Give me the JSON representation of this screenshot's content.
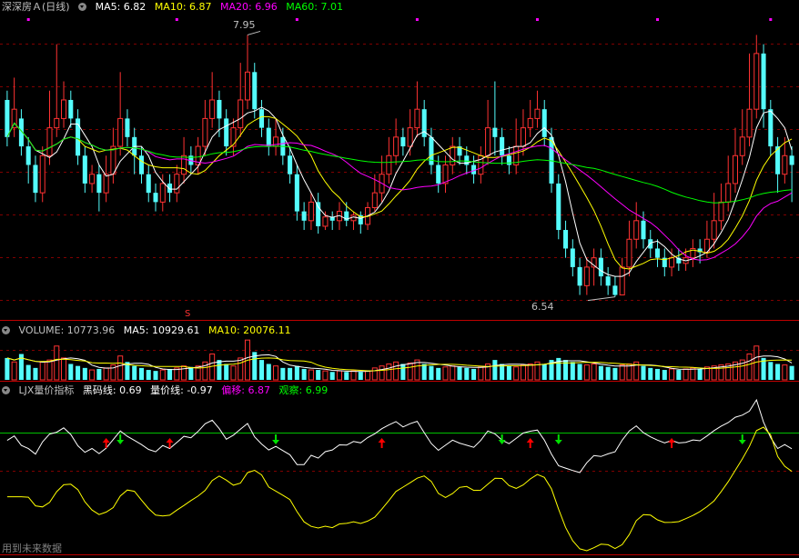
{
  "colors": {
    "up": "#ff3232",
    "down": "#54fcfc",
    "ma5": "#ffffff",
    "ma10": "#ffff00",
    "ma20": "#ff00ff",
    "ma60": "#00ff00",
    "grid": "#800000",
    "text": "#c0c0c0"
  },
  "main": {
    "title": "深深房Ａ(日线)",
    "ma5_label": "MA5: 6.82",
    "ma10_label": "MA10: 6.87",
    "ma20_label": "MA20: 6.96",
    "ma60_label": "MA60: 7.01",
    "high_label": "7.95",
    "low_label": "6.54",
    "marker_label": "S"
  },
  "volume": {
    "title": "VOLUME: 10773.96",
    "ma5_label": "MA5: 10929.61",
    "ma10_label": "MA10: 20076.11"
  },
  "indicator": {
    "title": "LJX量价指标",
    "black_label": "黑码线: 0.69",
    "price_label": "量价线: -0.97",
    "offset_label": "偏移: 6.87",
    "watch_label": "观察: 6.99"
  },
  "footer": {
    "label": "用到未来数据"
  },
  "chart_data": [
    {
      "type": "candlestick",
      "title": "深深房Ａ(日线)",
      "ylim": [
        6.45,
        8.05
      ],
      "annotations": [
        {
          "text": "7.95",
          "kind": "high"
        },
        {
          "text": "6.54",
          "kind": "low"
        }
      ],
      "series": [
        {
          "name": "MA5",
          "value": 6.82
        },
        {
          "name": "MA10",
          "value": 6.87
        },
        {
          "name": "MA20",
          "value": 6.96
        },
        {
          "name": "MA60",
          "value": 7.01
        }
      ],
      "ohlc": [
        [
          7.6,
          7.4,
          7.65,
          7.35
        ],
        [
          7.45,
          7.55,
          7.72,
          7.4
        ],
        [
          7.5,
          7.35,
          7.55,
          7.3
        ],
        [
          7.35,
          7.25,
          7.4,
          7.15
        ],
        [
          7.25,
          7.1,
          7.3,
          7.05
        ],
        [
          7.1,
          7.3,
          7.35,
          7.05
        ],
        [
          7.3,
          7.45,
          7.65,
          7.25
        ],
        [
          7.45,
          7.5,
          7.9,
          7.4
        ],
        [
          7.5,
          7.6,
          7.7,
          7.45
        ],
        [
          7.6,
          7.5,
          7.65,
          7.45
        ],
        [
          7.5,
          7.3,
          7.55,
          7.25
        ],
        [
          7.3,
          7.15,
          7.35,
          7.1
        ],
        [
          7.15,
          7.2,
          7.25,
          7.1
        ],
        [
          7.2,
          7.1,
          7.25,
          7.0
        ],
        [
          7.1,
          7.2,
          7.3,
          7.05
        ],
        [
          7.2,
          7.35,
          7.45,
          7.15
        ],
        [
          7.35,
          7.5,
          7.75,
          7.3
        ],
        [
          7.5,
          7.4,
          7.55,
          7.35
        ],
        [
          7.4,
          7.3,
          7.45,
          7.2
        ],
        [
          7.3,
          7.2,
          7.35,
          7.15
        ],
        [
          7.2,
          7.1,
          7.25,
          7.05
        ],
        [
          7.1,
          7.05,
          7.15,
          7.0
        ],
        [
          7.05,
          7.15,
          7.2,
          7.0
        ],
        [
          7.15,
          7.1,
          7.2,
          7.05
        ],
        [
          7.1,
          7.2,
          7.25,
          7.05
        ],
        [
          7.2,
          7.3,
          7.4,
          7.15
        ],
        [
          7.3,
          7.25,
          7.35,
          7.2
        ],
        [
          7.25,
          7.35,
          7.4,
          7.2
        ],
        [
          7.35,
          7.5,
          7.6,
          7.3
        ],
        [
          7.5,
          7.6,
          7.75,
          7.45
        ],
        [
          7.6,
          7.5,
          7.65,
          7.4
        ],
        [
          7.5,
          7.35,
          7.55,
          7.3
        ],
        [
          7.35,
          7.45,
          7.5,
          7.3
        ],
        [
          7.45,
          7.6,
          7.8,
          7.4
        ],
        [
          7.6,
          7.75,
          7.95,
          7.55
        ],
        [
          7.75,
          7.55,
          7.8,
          7.5
        ],
        [
          7.55,
          7.45,
          7.6,
          7.4
        ],
        [
          7.45,
          7.35,
          7.5,
          7.3
        ],
        [
          7.35,
          7.4,
          7.5,
          7.3
        ],
        [
          7.4,
          7.3,
          7.45,
          7.25
        ],
        [
          7.3,
          7.2,
          7.35,
          7.15
        ],
        [
          7.2,
          7.0,
          7.25,
          6.95
        ],
        [
          7.0,
          6.95,
          7.05,
          6.9
        ],
        [
          6.95,
          7.05,
          7.1,
          6.9
        ],
        [
          7.05,
          6.92,
          7.1,
          6.88
        ],
        [
          6.92,
          6.97,
          7.0,
          6.9
        ],
        [
          6.97,
          6.95,
          7.0,
          6.9
        ],
        [
          6.95,
          7.0,
          7.05,
          6.9
        ],
        [
          7.0,
          6.95,
          7.05,
          6.92
        ],
        [
          6.95,
          6.98,
          7.0,
          6.9
        ],
        [
          6.98,
          6.93,
          7.0,
          6.88
        ],
        [
          6.93,
          7.02,
          7.05,
          6.9
        ],
        [
          7.02,
          7.1,
          7.2,
          7.0
        ],
        [
          7.1,
          7.2,
          7.3,
          7.05
        ],
        [
          7.2,
          7.3,
          7.4,
          7.15
        ],
        [
          7.3,
          7.4,
          7.5,
          7.25
        ],
        [
          7.4,
          7.35,
          7.45,
          7.3
        ],
        [
          7.35,
          7.45,
          7.55,
          7.3
        ],
        [
          7.45,
          7.55,
          7.7,
          7.4
        ],
        [
          7.55,
          7.4,
          7.6,
          7.35
        ],
        [
          7.4,
          7.25,
          7.45,
          7.2
        ],
        [
          7.25,
          7.15,
          7.3,
          7.1
        ],
        [
          7.15,
          7.25,
          7.3,
          7.1
        ],
        [
          7.25,
          7.35,
          7.4,
          7.2
        ],
        [
          7.35,
          7.3,
          7.4,
          7.25
        ],
        [
          7.3,
          7.25,
          7.35,
          7.2
        ],
        [
          7.25,
          7.2,
          7.3,
          7.15
        ],
        [
          7.2,
          7.3,
          7.35,
          7.15
        ],
        [
          7.3,
          7.45,
          7.6,
          7.25
        ],
        [
          7.45,
          7.4,
          7.7,
          7.3
        ],
        [
          7.4,
          7.3,
          7.45,
          7.25
        ],
        [
          7.3,
          7.25,
          7.35,
          7.2
        ],
        [
          7.25,
          7.35,
          7.5,
          7.2
        ],
        [
          7.35,
          7.45,
          7.55,
          7.3
        ],
        [
          7.45,
          7.5,
          7.6,
          7.4
        ],
        [
          7.5,
          7.55,
          7.65,
          7.45
        ],
        [
          7.55,
          7.4,
          7.6,
          7.35
        ],
        [
          7.4,
          7.15,
          7.45,
          7.1
        ],
        [
          7.15,
          6.9,
          7.2,
          6.85
        ],
        [
          6.9,
          6.8,
          6.95,
          6.75
        ],
        [
          6.8,
          6.7,
          6.85,
          6.65
        ],
        [
          6.7,
          6.6,
          6.75,
          6.55
        ],
        [
          6.6,
          6.7,
          6.75,
          6.55
        ],
        [
          6.7,
          6.75,
          6.8,
          6.6
        ],
        [
          6.75,
          6.65,
          6.8,
          6.6
        ],
        [
          6.65,
          6.6,
          6.7,
          6.55
        ],
        [
          6.6,
          6.55,
          6.65,
          6.54
        ],
        [
          6.55,
          6.7,
          6.75,
          6.55
        ],
        [
          6.7,
          6.85,
          6.95,
          6.65
        ],
        [
          6.85,
          6.95,
          7.05,
          6.8
        ],
        [
          6.95,
          6.85,
          7.0,
          6.8
        ],
        [
          6.85,
          6.8,
          6.9,
          6.75
        ],
        [
          6.8,
          6.75,
          6.85,
          6.7
        ],
        [
          6.75,
          6.7,
          6.8,
          6.65
        ],
        [
          6.7,
          6.75,
          6.8,
          6.65
        ],
        [
          6.75,
          6.72,
          6.8,
          6.68
        ],
        [
          6.72,
          6.75,
          6.8,
          6.68
        ],
        [
          6.75,
          6.8,
          6.85,
          6.7
        ],
        [
          6.8,
          6.78,
          6.85,
          6.72
        ],
        [
          6.78,
          6.85,
          6.95,
          6.75
        ],
        [
          6.85,
          6.95,
          7.1,
          6.8
        ],
        [
          6.95,
          7.05,
          7.15,
          6.9
        ],
        [
          7.05,
          7.15,
          7.3,
          7.0
        ],
        [
          7.15,
          7.3,
          7.45,
          7.1
        ],
        [
          7.3,
          7.4,
          7.55,
          7.25
        ],
        [
          7.4,
          7.55,
          7.85,
          7.35
        ],
        [
          7.55,
          7.85,
          7.95,
          7.5
        ],
        [
          7.85,
          7.55,
          7.9,
          7.45
        ],
        [
          7.55,
          7.35,
          7.6,
          7.3
        ],
        [
          7.35,
          7.2,
          7.4,
          7.1
        ],
        [
          7.2,
          7.3,
          7.4,
          7.15
        ],
        [
          7.3,
          7.25,
          7.35,
          7.05
        ]
      ]
    },
    {
      "type": "bar",
      "title": "VOLUME: 10773.96",
      "series": [
        {
          "name": "MA5",
          "value": 10929.61
        },
        {
          "name": "MA10",
          "value": 20076.11
        }
      ],
      "values": [
        22,
        18,
        26,
        15,
        12,
        18,
        20,
        34,
        22,
        16,
        14,
        12,
        10,
        11,
        12,
        15,
        24,
        18,
        14,
        12,
        10,
        9,
        10,
        11,
        12,
        14,
        13,
        14,
        18,
        26,
        20,
        16,
        14,
        22,
        40,
        28,
        20,
        16,
        14,
        12,
        12,
        14,
        11,
        10,
        10,
        9,
        8,
        9,
        8,
        9,
        8,
        9,
        12,
        14,
        16,
        18,
        16,
        17,
        20,
        16,
        14,
        12,
        13,
        14,
        13,
        12,
        11,
        13,
        16,
        20,
        16,
        14,
        13,
        15,
        16,
        18,
        16,
        20,
        22,
        20,
        18,
        16,
        15,
        16,
        14,
        13,
        12,
        15,
        16,
        18,
        14,
        12,
        11,
        10,
        11,
        10,
        11,
        12,
        11,
        13,
        14,
        15,
        16,
        18,
        20,
        26,
        34,
        22,
        18,
        16,
        15,
        14
      ]
    },
    {
      "type": "line",
      "title": "LJX量价指标",
      "series": [
        {
          "name": "黑码线",
          "value": 0.69
        },
        {
          "name": "量价线",
          "value": -0.97
        },
        {
          "name": "偏移",
          "value": 6.87
        },
        {
          "name": "观察",
          "value": 6.99
        }
      ]
    }
  ]
}
